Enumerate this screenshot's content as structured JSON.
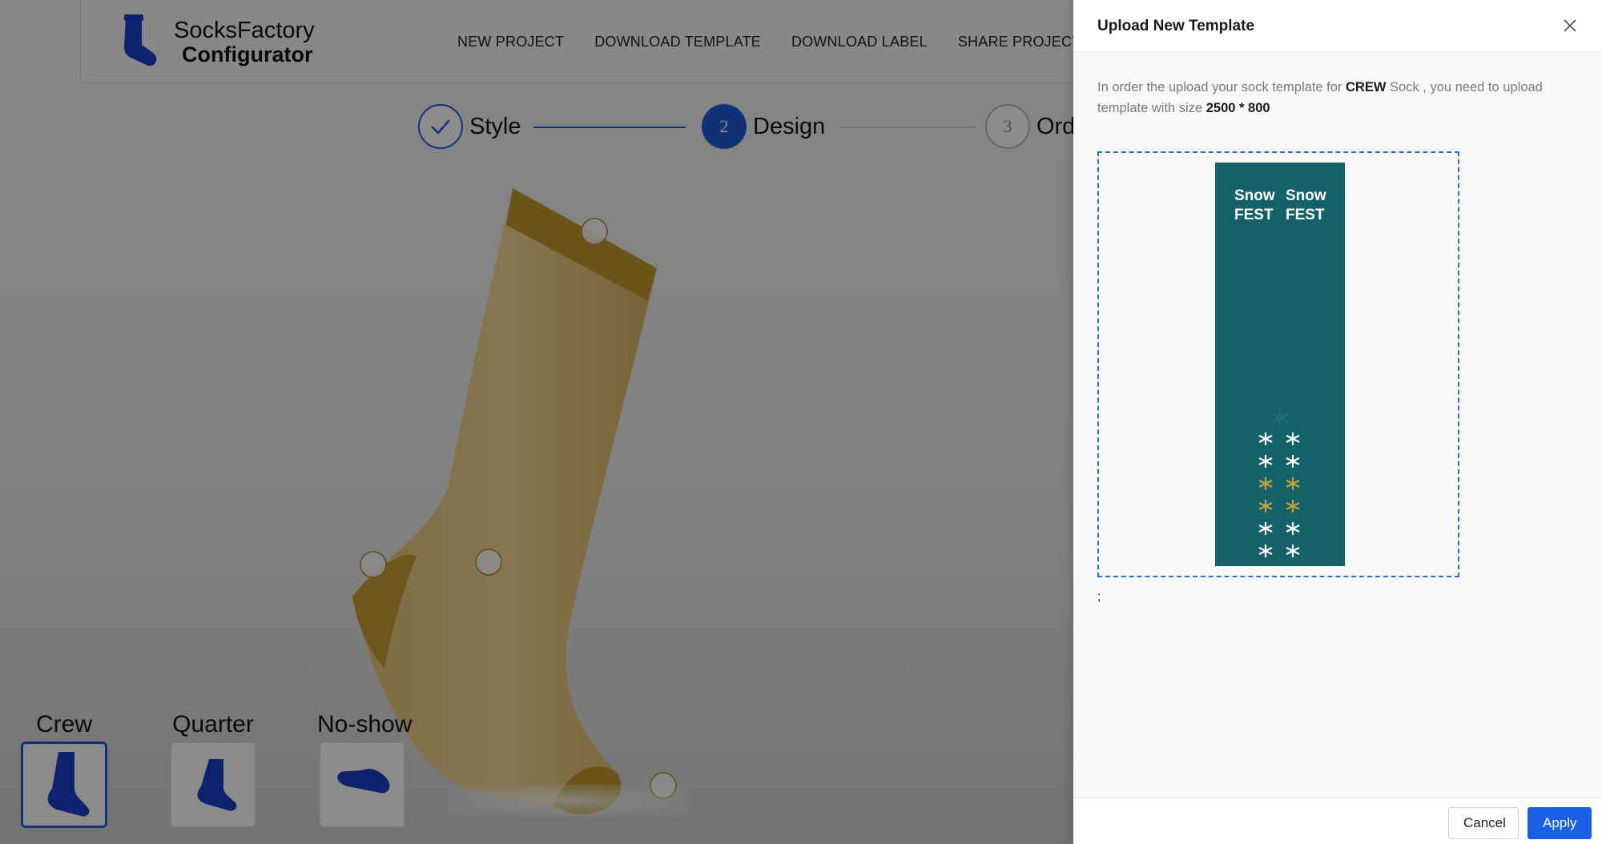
{
  "app": {
    "brand_line1": "SocksFactory",
    "brand_line2": "Configurator",
    "nav": [
      "NEW PROJECT",
      "DOWNLOAD TEMPLATE",
      "DOWNLOAD LABEL",
      "SHARE PROJECT"
    ],
    "steps": [
      {
        "label": "Style",
        "state": "done"
      },
      {
        "label": "Design",
        "number": "2",
        "state": "active"
      },
      {
        "label": "Ord",
        "number": "3",
        "state": "pending"
      }
    ],
    "styles": [
      {
        "label": "Crew",
        "selected": true
      },
      {
        "label": "Quarter",
        "selected": false
      },
      {
        "label": "No-show",
        "selected": false
      }
    ],
    "sock_color": "#d9b65f",
    "accent_color": "#1f5bd8"
  },
  "drawer": {
    "title": "Upload New Template",
    "desc_part1": "In order the upload your sock template for ",
    "desc_sock": "CREW",
    "desc_part2": " Sock , you need to upload template with size ",
    "desc_size": "2500 * 800",
    "template_text_left": [
      "Snow",
      "FEST"
    ],
    "template_text_right": [
      "Snow",
      "FEST"
    ],
    "template_bg": "#14616a",
    "trailing_text": ";",
    "cancel_label": "Cancel",
    "apply_label": "Apply",
    "apply_color": "#1a5fe6"
  }
}
